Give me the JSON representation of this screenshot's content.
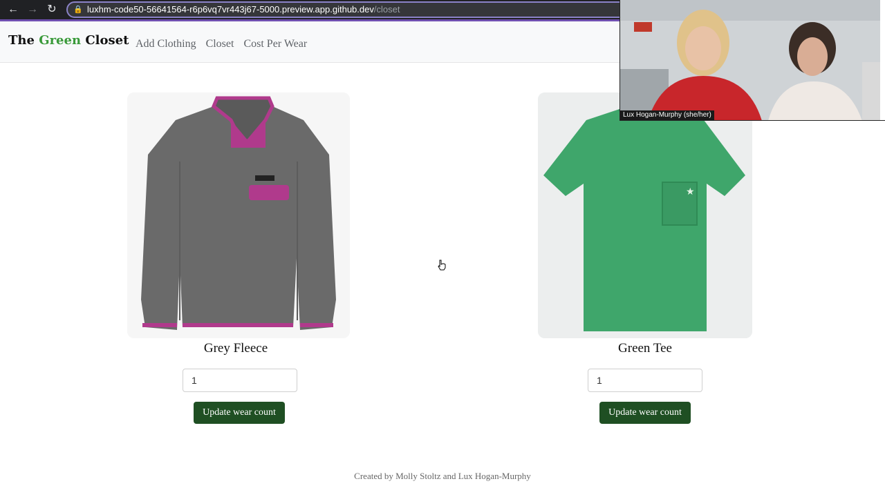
{
  "browser": {
    "url_host": "luxhm-code50-56641564-r6p6vq7vr443j67-5000.preview.app.github.dev",
    "url_path": "/closet",
    "icons": [
      "back-arrow-icon",
      "forward-arrow-icon",
      "reload-icon",
      "lock-icon"
    ]
  },
  "navbar": {
    "brand_prefix": "The ",
    "brand_green": "Green",
    "brand_suffix": " Closet",
    "links": [
      "Add Clothing",
      "Closet",
      "Cost Per Wear"
    ],
    "brand_green_color": "#3a9a3a"
  },
  "items": [
    {
      "name": "Grey Fleece",
      "input_value": "1",
      "button_label": "Update wear count",
      "image_icon": "grey-fleece-pullover-image"
    },
    {
      "name": "Green Tee",
      "input_value": "1",
      "button_label": "Update wear count",
      "image_icon": "green-tshirt-image"
    }
  ],
  "footer": {
    "text": "Created by Molly Stoltz and Lux Hogan-Murphy"
  },
  "video_call": {
    "caption": "Lux Hogan-Murphy (she/her)"
  },
  "colors": {
    "button_bg": "#1f4f23",
    "accent_bar": "#6f4fb0"
  }
}
